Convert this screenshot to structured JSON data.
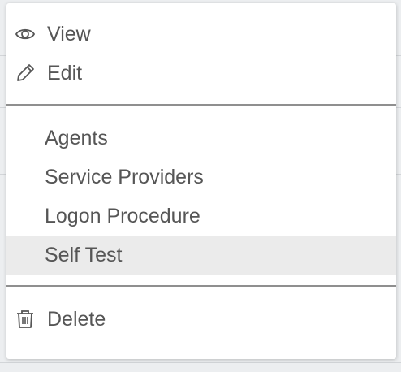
{
  "menu": {
    "items": [
      {
        "label": "View",
        "icon": "eye-icon"
      },
      {
        "label": "Edit",
        "icon": "pencil-icon"
      },
      {
        "label": "Agents"
      },
      {
        "label": "Service Providers"
      },
      {
        "label": "Logon Procedure"
      },
      {
        "label": "Self Test",
        "highlighted": true
      },
      {
        "label": "Delete",
        "icon": "trash-icon"
      }
    ]
  },
  "colors": {
    "text": "#565656",
    "highlight": "#ebebeb",
    "divider": "#8f8f8f",
    "background": "#ffffff"
  }
}
